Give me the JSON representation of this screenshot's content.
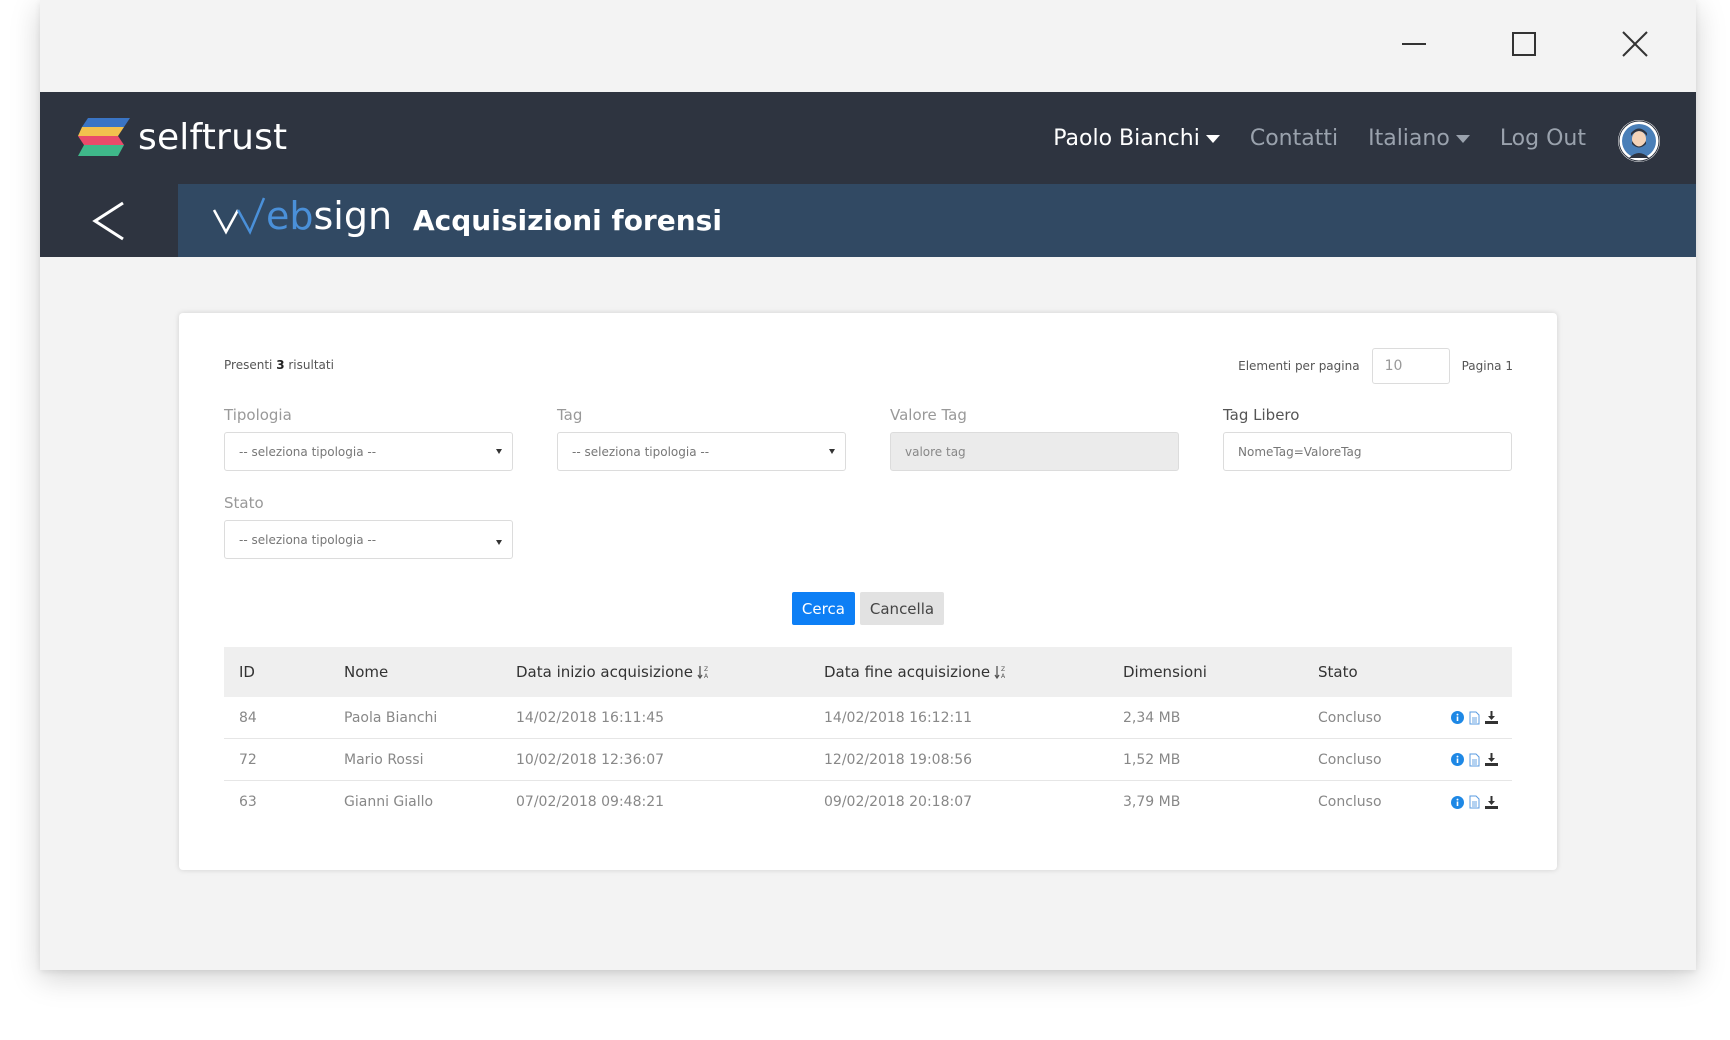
{
  "header": {
    "brand": "selftrust",
    "nav": {
      "user": "Paolo Bianchi",
      "contacts": "Contatti",
      "language": "Italiano",
      "logout": "Log Out"
    }
  },
  "subheader": {
    "websign_prefix": "w",
    "websign_mid": "eb",
    "websign_suffix": "sign",
    "title": "Acquisizioni forensi"
  },
  "results": {
    "prefix": "Presenti",
    "count": "3",
    "suffix": "risultati"
  },
  "pagination": {
    "per_page_label": "Elementi per pagina",
    "per_page_value": "10",
    "page_label": "Pagina 1"
  },
  "filters": {
    "tipologia": {
      "label": "Tipologia",
      "value": "-- seleziona tipologia --"
    },
    "tag": {
      "label": "Tag",
      "value": "-- seleziona tipologia --"
    },
    "valore_tag": {
      "label": "Valore Tag",
      "placeholder": "valore tag"
    },
    "tag_libero": {
      "label": "Tag Libero",
      "placeholder": "NomeTag=ValoreTag"
    },
    "stato": {
      "label": "Stato",
      "value": "-- seleziona tipologia --"
    }
  },
  "buttons": {
    "search": "Cerca",
    "cancel": "Cancella"
  },
  "table": {
    "headers": {
      "id": "ID",
      "nome": "Nome",
      "start": "Data inizio acquisizione",
      "end": "Data fine acquisizione",
      "dim": "Dimensioni",
      "stato": "Stato"
    },
    "rows": [
      {
        "id": "84",
        "nome": "Paola Bianchi",
        "start": "14/02/2018 16:11:45",
        "end": "14/02/2018 16:12:11",
        "dim": "2,34 MB",
        "stato": "Concluso"
      },
      {
        "id": "72",
        "nome": "Mario Rossi",
        "start": "10/02/2018 12:36:07",
        "end": "12/02/2018 19:08:56",
        "dim": "1,52 MB",
        "stato": "Concluso"
      },
      {
        "id": "63",
        "nome": "Gianni Giallo",
        "start": "07/02/2018 09:48:21",
        "end": "09/02/2018 20:18:07",
        "dim": "3,79 MB",
        "stato": "Concluso"
      }
    ]
  },
  "icons": {
    "window_controls": [
      "minimize-icon",
      "maximize-icon",
      "close-icon"
    ],
    "row_actions": [
      "info-icon",
      "document-icon",
      "download-icon"
    ]
  },
  "colors": {
    "appbar": "#2e3440",
    "subbar": "#314963",
    "primary": "#0d7ff5",
    "info": "#1e88e5",
    "websign_accent": "#4a90d9"
  }
}
